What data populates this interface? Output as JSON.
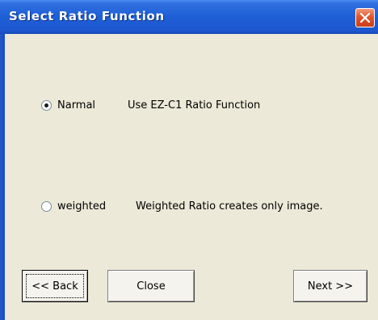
{
  "window": {
    "title": "Select Ratio Function"
  },
  "options": [
    {
      "label": "Narmal",
      "description": "Use EZ-C1 Ratio Function",
      "selected": true
    },
    {
      "label": "weighted",
      "description": "Weighted Ratio creates only image.",
      "selected": false
    }
  ],
  "buttons": {
    "back": "<< Back",
    "close": "Close",
    "next": "Next >>"
  },
  "colors": {
    "titlebar": "#1f5fd6",
    "close_button": "#e0552a",
    "background": "#ece9d8"
  }
}
